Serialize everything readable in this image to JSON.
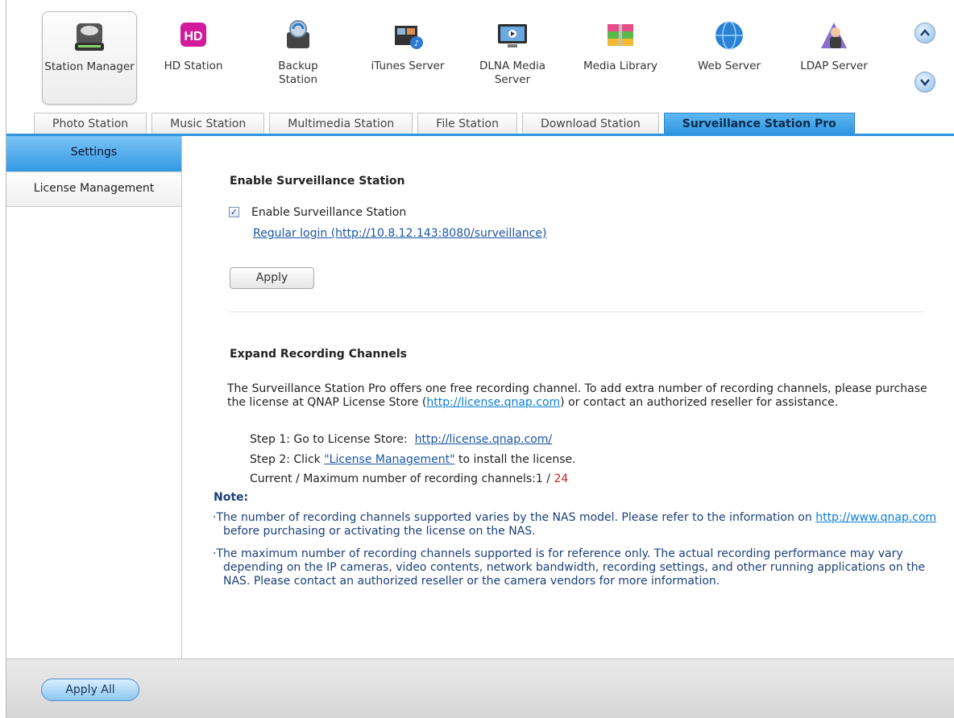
{
  "apps": [
    {
      "label": "Station Manager",
      "icon": "station-manager-icon",
      "selected": true
    },
    {
      "label": "HD Station",
      "icon": "hd-station-icon"
    },
    {
      "label": "Backup Station",
      "icon": "backup-station-icon"
    },
    {
      "label": "iTunes Server",
      "icon": "itunes-server-icon"
    },
    {
      "label": "DLNA Media Server",
      "icon": "dlna-media-server-icon"
    },
    {
      "label": "Media Library",
      "icon": "media-library-icon"
    },
    {
      "label": "Web Server",
      "icon": "web-server-icon"
    },
    {
      "label": "LDAP Server",
      "icon": "ldap-server-icon"
    }
  ],
  "hd_icon_text": "HD",
  "scroll": {
    "up": "chevron-up-icon",
    "down": "chevron-down-icon"
  },
  "tabs": [
    {
      "label": "Photo Station"
    },
    {
      "label": "Music Station"
    },
    {
      "label": "Multimedia Station"
    },
    {
      "label": "File Station"
    },
    {
      "label": "Download Station"
    },
    {
      "label": "Surveillance Station Pro",
      "active": true
    }
  ],
  "sidebar": {
    "items": [
      {
        "label": "Settings",
        "active": true
      },
      {
        "label": "License Management"
      }
    ]
  },
  "enable_section": {
    "heading": "Enable Surveillance Station",
    "checkbox_label": "Enable Surveillance Station",
    "checked": true,
    "check_mark": "✓",
    "login_link": "Regular login (http://10.8.12.143:8080/surveillance)",
    "apply_label": "Apply"
  },
  "expand_section": {
    "heading": "Expand Recording Channels",
    "para_a": "The Surveillance Station Pro offers one free recording channel. To add extra number of recording channels, please purchase the license at QNAP License Store (",
    "para_link": "http://license.qnap.com",
    "para_b": ") or contact an authorized reseller for assistance.",
    "step1_text": "Step 1: Go to License Store:",
    "step1_link": "http://license.qnap.com/",
    "step2_a": "Step 2: Click",
    "step2_link": "\"License Management\"",
    "step2_b": "to install the license.",
    "channels_text": "Current / Maximum number of recording channels:",
    "current_channels": "1",
    "slash": " / ",
    "max_channels": "24"
  },
  "notes": {
    "title": "Note:",
    "note1_a": "·The number of recording channels supported varies by the NAS model. Please refer to the information on ",
    "note1_link": "http://www.qnap.com",
    "note1_b": " before purchasing or activating the license on the NAS.",
    "note2": "·The maximum number of recording channels supported is for reference only. The actual recording performance may vary depending on the IP cameras, video contents, network bandwidth, recording settings, and other running applications on the NAS. Please contact an authorized reseller or the camera vendors for more information."
  },
  "footer": {
    "apply_all_label": "Apply All"
  },
  "colors": {
    "accent": "#2e95e0",
    "link": "#1a55a6",
    "note": "#1a3f7a",
    "max_channels": "#d62020"
  }
}
